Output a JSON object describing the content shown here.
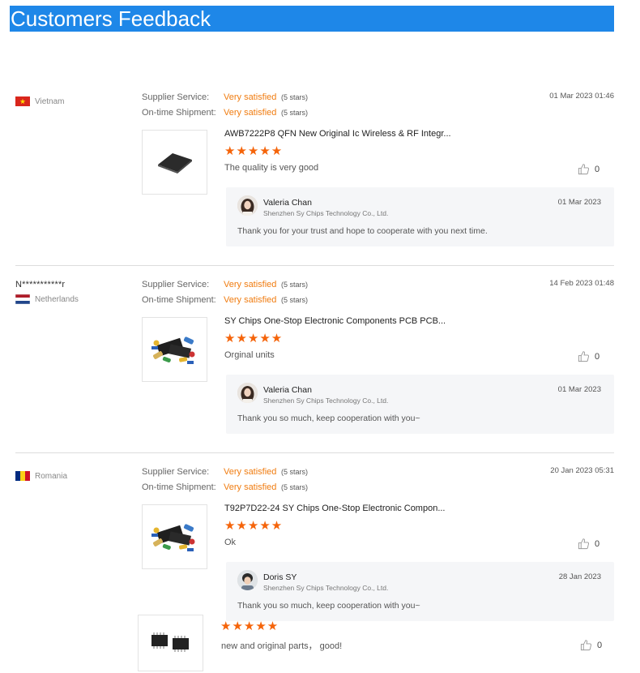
{
  "header": {
    "title": "Customers Feedback"
  },
  "labels": {
    "supplier_service": "Supplier Service:",
    "ontime_shipment": "On-time Shipment:"
  },
  "reviews": [
    {
      "buyer_name": "",
      "country": "Vietnam",
      "flag": "vietnam-flag",
      "supplier_value": "Very satisfied",
      "supplier_count": "(5 stars)",
      "shipment_value": "Very satisfied",
      "shipment_count": "(5 stars)",
      "date": "01 Mar 2023 01:46",
      "product": "AWB7222P8 QFN New Original Ic Wireless & RF Integr...",
      "stars": "★★★★★",
      "comment": "The quality is very good",
      "likes": "0",
      "reply": {
        "name": "Valeria Chan",
        "company": "Shenzhen Sy Chips Technology Co., Ltd.",
        "date": "01 Mar 2023",
        "text": "Thank you for your trust and hope to cooperate with you next time."
      }
    },
    {
      "buyer_name": "N***********r",
      "country": "Netherlands",
      "flag": "netherlands-flag",
      "supplier_value": "Very satisfied",
      "supplier_count": "(5 stars)",
      "shipment_value": "Very satisfied",
      "shipment_count": "(5 stars)",
      "date": "14 Feb 2023 01:48",
      "product": "SY Chips One-Stop Electronic Components PCB PCB...",
      "stars": "★★★★★",
      "comment": "Orginal units",
      "likes": "0",
      "reply": {
        "name": "Valeria Chan",
        "company": "Shenzhen Sy Chips Technology Co., Ltd.",
        "date": "01 Mar 2023",
        "text": "Thank you so much, keep cooperation with you~"
      }
    },
    {
      "buyer_name": "",
      "country": "Romania",
      "flag": "romania-flag",
      "supplier_value": "Very satisfied",
      "supplier_count": "(5 stars)",
      "shipment_value": "Very satisfied",
      "shipment_count": "(5 stars)",
      "date": "20 Jan 2023 05:31",
      "product": "T92P7D22-24 SY Chips One-Stop Electronic Compon...",
      "stars": "★★★★★",
      "comment": "Ok",
      "likes": "0",
      "reply": {
        "name": "Doris SY",
        "company": "Shenzhen Sy Chips Technology Co., Ltd.",
        "date": "28 Jan 2023",
        "text": "Thank you so much, keep cooperation with you~"
      }
    },
    {
      "stars": "★★★★★",
      "comment": "new and original parts， good!",
      "likes": "0"
    }
  ],
  "colors": {
    "banner": "#1e87e8",
    "accent": "#f07c10",
    "star": "#f5640a"
  }
}
